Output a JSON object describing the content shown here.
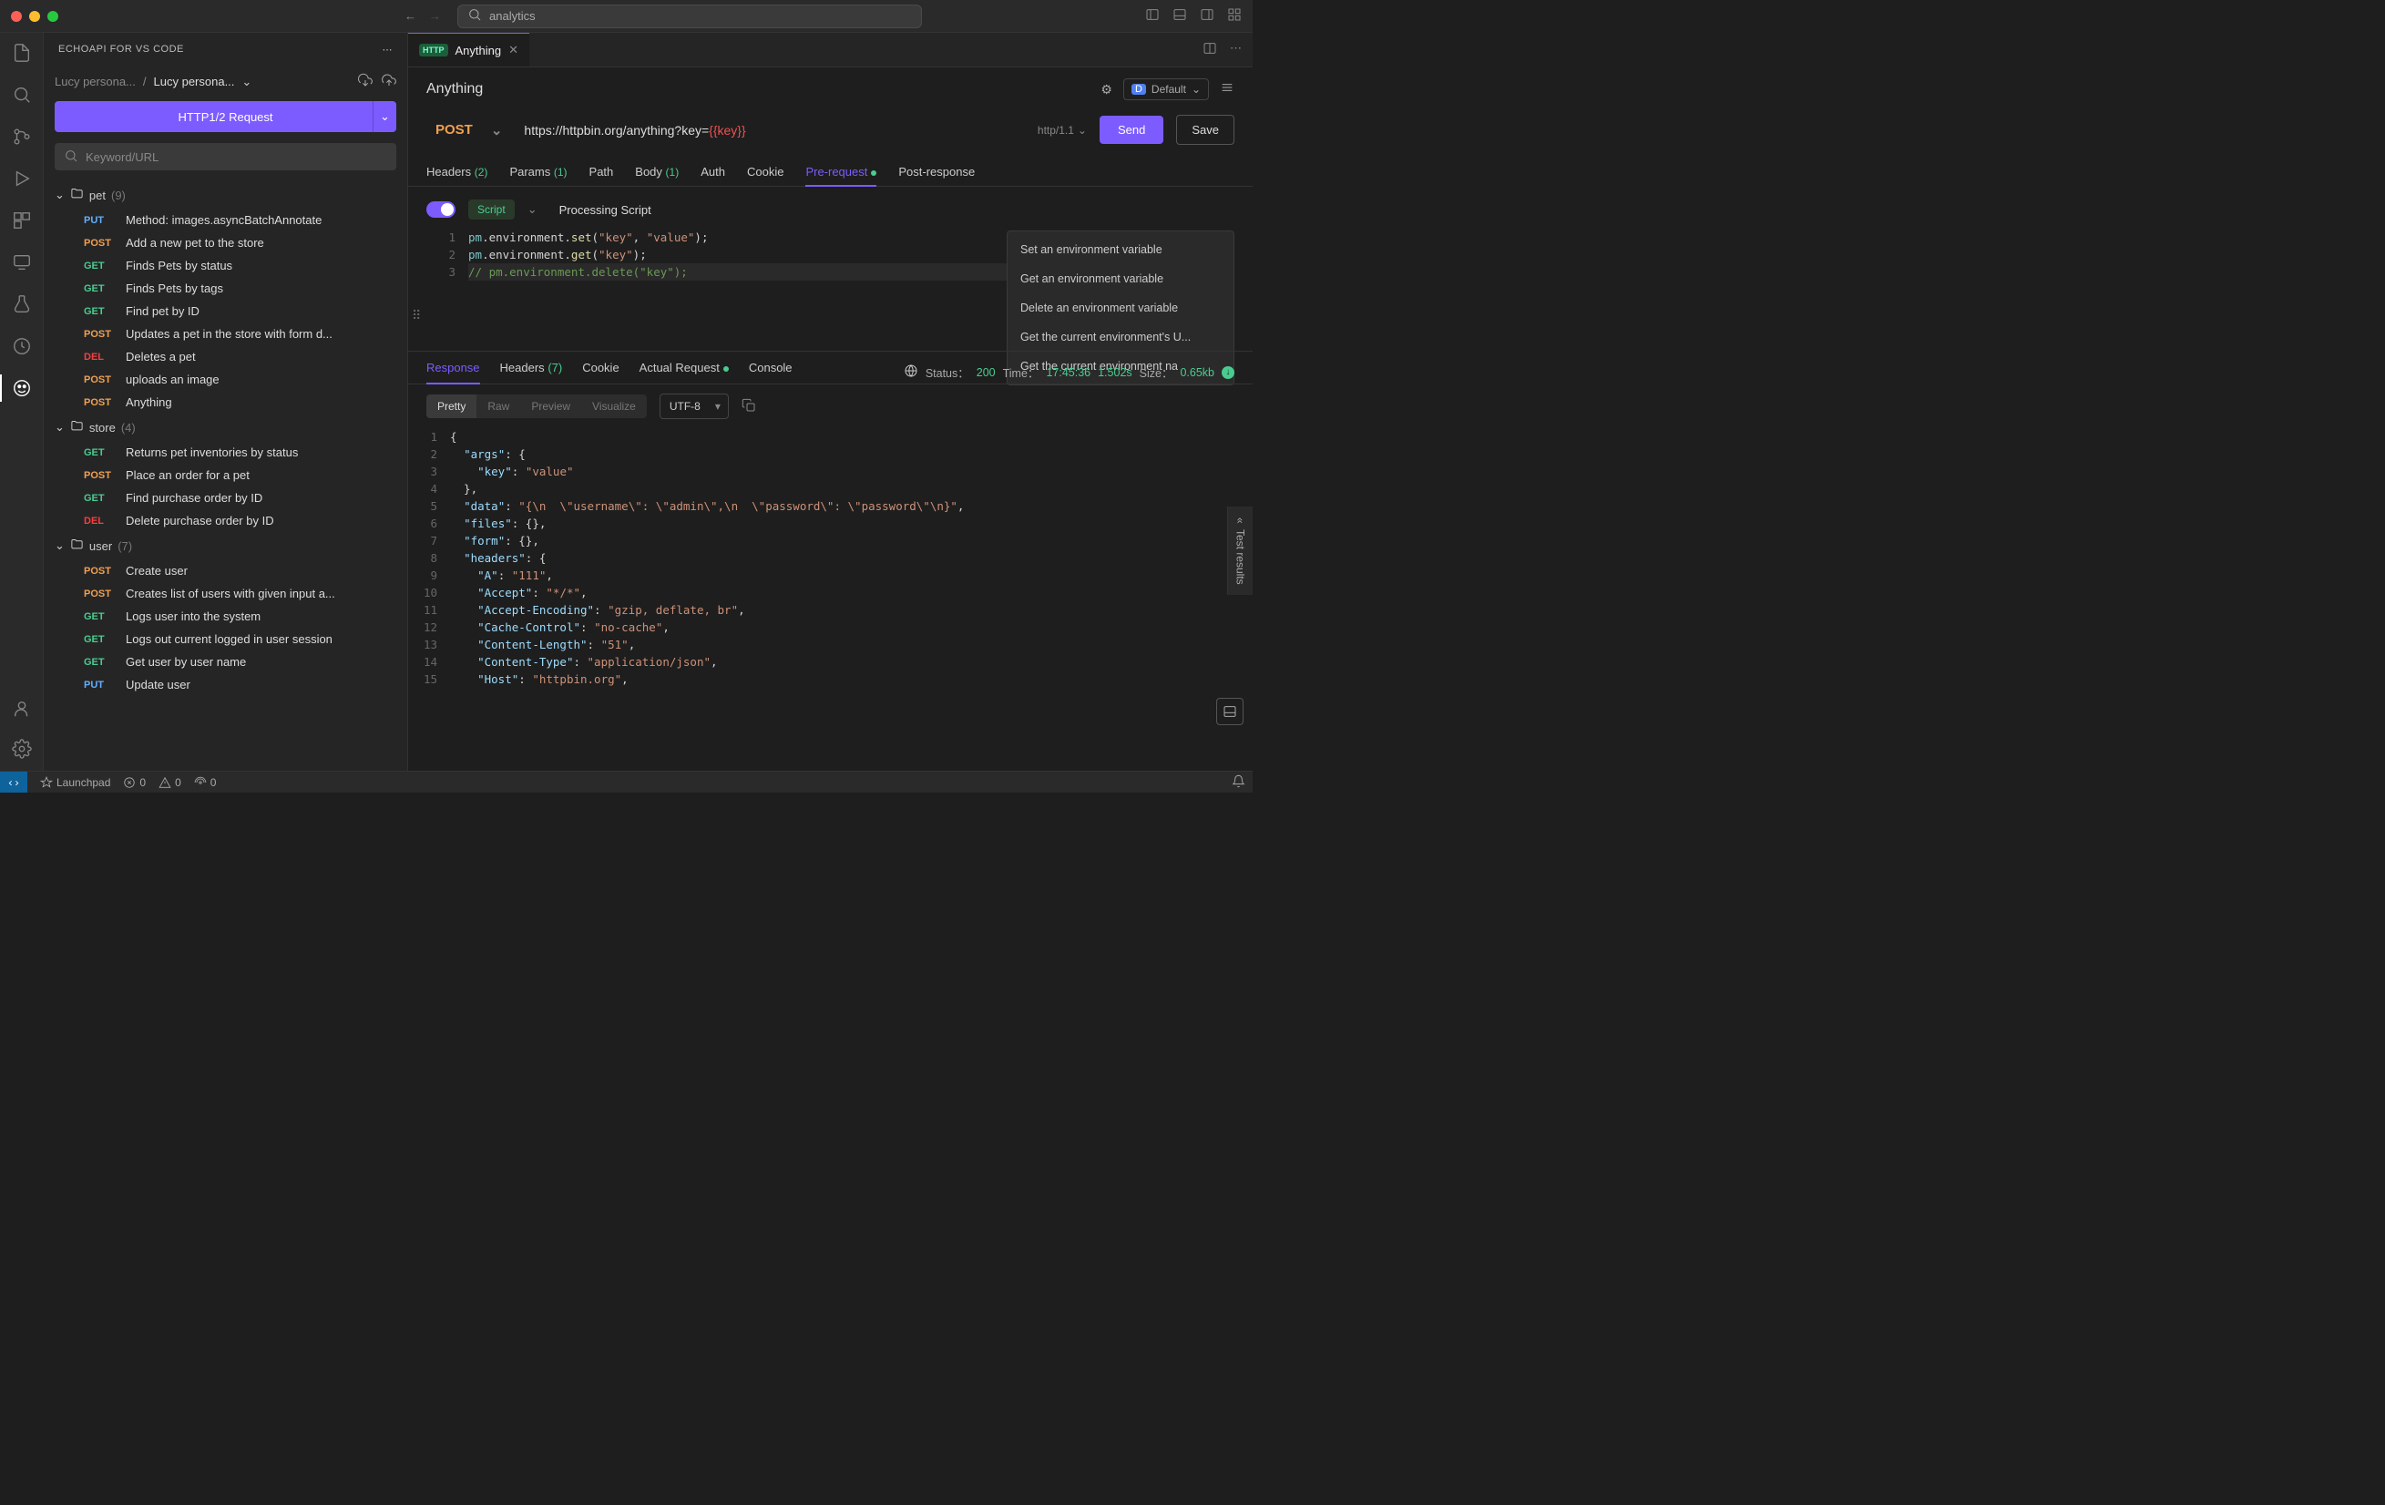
{
  "titlebar": {
    "search": "analytics"
  },
  "sidebar": {
    "title": "ECHOAPI FOR VS CODE",
    "breadcrumb": {
      "parent": "Lucy persona...",
      "current": "Lucy persona..."
    },
    "newRequest": "HTTP1/2 Request",
    "searchPlaceholder": "Keyword/URL",
    "folders": [
      {
        "name": "pet",
        "count": "(9)",
        "items": [
          {
            "method": "PUT",
            "cls": "m-put",
            "label": "Method: images.asyncBatchAnnotate"
          },
          {
            "method": "POST",
            "cls": "m-post",
            "label": "Add a new pet to the store"
          },
          {
            "method": "GET",
            "cls": "m-get",
            "label": "Finds Pets by status"
          },
          {
            "method": "GET",
            "cls": "m-get",
            "label": "Finds Pets by tags"
          },
          {
            "method": "GET",
            "cls": "m-get",
            "label": "Find pet by ID"
          },
          {
            "method": "POST",
            "cls": "m-post",
            "label": "Updates a pet in the store with form d..."
          },
          {
            "method": "DEL",
            "cls": "m-del",
            "label": "Deletes a pet"
          },
          {
            "method": "POST",
            "cls": "m-post",
            "label": "uploads an image"
          },
          {
            "method": "POST",
            "cls": "m-post",
            "label": "Anything"
          }
        ]
      },
      {
        "name": "store",
        "count": "(4)",
        "items": [
          {
            "method": "GET",
            "cls": "m-get",
            "label": "Returns pet inventories by status"
          },
          {
            "method": "POST",
            "cls": "m-post",
            "label": "Place an order for a pet"
          },
          {
            "method": "GET",
            "cls": "m-get",
            "label": "Find purchase order by ID"
          },
          {
            "method": "DEL",
            "cls": "m-del",
            "label": "Delete purchase order by ID"
          }
        ]
      },
      {
        "name": "user",
        "count": "(7)",
        "items": [
          {
            "method": "POST",
            "cls": "m-post",
            "label": "Create user"
          },
          {
            "method": "POST",
            "cls": "m-post",
            "label": "Creates list of users with given input a..."
          },
          {
            "method": "GET",
            "cls": "m-get",
            "label": "Logs user into the system"
          },
          {
            "method": "GET",
            "cls": "m-get",
            "label": "Logs out current logged in user session"
          },
          {
            "method": "GET",
            "cls": "m-get",
            "label": "Get user by user name"
          },
          {
            "method": "PUT",
            "cls": "m-put",
            "label": "Update user"
          }
        ]
      }
    ]
  },
  "editor": {
    "tabLabel": "Anything",
    "title": "Anything",
    "env": "Default",
    "method": "POST",
    "urlBase": "https://httpbin.org/anything?key=",
    "urlVar": "{{key}}",
    "protocol": "http/1.1",
    "sendBtn": "Send",
    "saveBtn": "Save",
    "tabs": {
      "headers": "Headers",
      "headersCount": "(2)",
      "params": "Params",
      "paramsCount": "(1)",
      "path": "Path",
      "body": "Body",
      "bodyCount": "(1)",
      "auth": "Auth",
      "cookie": "Cookie",
      "preRequest": "Pre-request",
      "postResponse": "Post-response"
    },
    "script": {
      "badge": "Script",
      "title": "Processing Script",
      "lines": [
        [
          {
            "t": "pm",
            "c": "tk-var"
          },
          {
            "t": ".",
            "c": "tk-punc"
          },
          {
            "t": "environment",
            "c": "tk-prop"
          },
          {
            "t": ".",
            "c": "tk-punc"
          },
          {
            "t": "set",
            "c": "tk-func"
          },
          {
            "t": "(",
            "c": "tk-punc"
          },
          {
            "t": "\"key\"",
            "c": "tk-str"
          },
          {
            "t": ", ",
            "c": "tk-punc"
          },
          {
            "t": "\"value\"",
            "c": "tk-str"
          },
          {
            "t": ");",
            "c": "tk-punc"
          }
        ],
        [
          {
            "t": "pm",
            "c": "tk-var"
          },
          {
            "t": ".",
            "c": "tk-punc"
          },
          {
            "t": "environment",
            "c": "tk-prop"
          },
          {
            "t": ".",
            "c": "tk-punc"
          },
          {
            "t": "get",
            "c": "tk-func"
          },
          {
            "t": "(",
            "c": "tk-punc"
          },
          {
            "t": "\"key\"",
            "c": "tk-str"
          },
          {
            "t": ");",
            "c": "tk-punc"
          }
        ],
        [
          {
            "t": "// pm.environment.delete(\"key\");",
            "c": "tk-comment"
          }
        ]
      ],
      "snippets": [
        "Set an environment variable",
        "Get an environment variable",
        "Delete an environment variable",
        "Get the current environment's U...",
        "Get the current environment na"
      ]
    }
  },
  "response": {
    "tabs": {
      "response": "Response",
      "headers": "Headers",
      "headersCount": "(7)",
      "cookie": "Cookie",
      "actualRequest": "Actual Request",
      "console": "Console"
    },
    "status": {
      "statusLbl": "Status：",
      "statusVal": "200",
      "timeLbl": "Time：",
      "timeVal1": "17:45:36",
      "timeVal2": "1.502s",
      "sizeLbl": "Size：",
      "sizeVal": "0.65kb"
    },
    "viewTabs": {
      "pretty": "Pretty",
      "raw": "Raw",
      "preview": "Preview",
      "visualize": "Visualize"
    },
    "encoding": "UTF-8",
    "body": [
      [
        {
          "t": "{",
          "c": "tk-punc"
        }
      ],
      [
        {
          "t": "  ",
          "c": ""
        },
        {
          "t": "\"args\"",
          "c": "tk-key"
        },
        {
          "t": ": {",
          "c": "tk-punc"
        }
      ],
      [
        {
          "t": "    ",
          "c": ""
        },
        {
          "t": "\"key\"",
          "c": "tk-key"
        },
        {
          "t": ": ",
          "c": "tk-punc"
        },
        {
          "t": "\"value\"",
          "c": "tk-str"
        }
      ],
      [
        {
          "t": "  },",
          "c": "tk-punc"
        }
      ],
      [
        {
          "t": "  ",
          "c": ""
        },
        {
          "t": "\"data\"",
          "c": "tk-key"
        },
        {
          "t": ": ",
          "c": "tk-punc"
        },
        {
          "t": "\"{\\n  \\\"username\\\": \\\"admin\\\",\\n  \\\"password\\\": \\\"password\\\"\\n}\"",
          "c": "tk-str"
        },
        {
          "t": ",",
          "c": "tk-punc"
        }
      ],
      [
        {
          "t": "  ",
          "c": ""
        },
        {
          "t": "\"files\"",
          "c": "tk-key"
        },
        {
          "t": ": {},",
          "c": "tk-punc"
        }
      ],
      [
        {
          "t": "  ",
          "c": ""
        },
        {
          "t": "\"form\"",
          "c": "tk-key"
        },
        {
          "t": ": {},",
          "c": "tk-punc"
        }
      ],
      [
        {
          "t": "  ",
          "c": ""
        },
        {
          "t": "\"headers\"",
          "c": "tk-key"
        },
        {
          "t": ": {",
          "c": "tk-punc"
        }
      ],
      [
        {
          "t": "    ",
          "c": ""
        },
        {
          "t": "\"A\"",
          "c": "tk-key"
        },
        {
          "t": ": ",
          "c": "tk-punc"
        },
        {
          "t": "\"111\"",
          "c": "tk-str"
        },
        {
          "t": ",",
          "c": "tk-punc"
        }
      ],
      [
        {
          "t": "    ",
          "c": ""
        },
        {
          "t": "\"Accept\"",
          "c": "tk-key"
        },
        {
          "t": ": ",
          "c": "tk-punc"
        },
        {
          "t": "\"*/*\"",
          "c": "tk-str"
        },
        {
          "t": ",",
          "c": "tk-punc"
        }
      ],
      [
        {
          "t": "    ",
          "c": ""
        },
        {
          "t": "\"Accept-Encoding\"",
          "c": "tk-key"
        },
        {
          "t": ": ",
          "c": "tk-punc"
        },
        {
          "t": "\"gzip, deflate, br\"",
          "c": "tk-str"
        },
        {
          "t": ",",
          "c": "tk-punc"
        }
      ],
      [
        {
          "t": "    ",
          "c": ""
        },
        {
          "t": "\"Cache-Control\"",
          "c": "tk-key"
        },
        {
          "t": ": ",
          "c": "tk-punc"
        },
        {
          "t": "\"no-cache\"",
          "c": "tk-str"
        },
        {
          "t": ",",
          "c": "tk-punc"
        }
      ],
      [
        {
          "t": "    ",
          "c": ""
        },
        {
          "t": "\"Content-Length\"",
          "c": "tk-key"
        },
        {
          "t": ": ",
          "c": "tk-punc"
        },
        {
          "t": "\"51\"",
          "c": "tk-str"
        },
        {
          "t": ",",
          "c": "tk-punc"
        }
      ],
      [
        {
          "t": "    ",
          "c": ""
        },
        {
          "t": "\"Content-Type\"",
          "c": "tk-key"
        },
        {
          "t": ": ",
          "c": "tk-punc"
        },
        {
          "t": "\"application/json\"",
          "c": "tk-str"
        },
        {
          "t": ",",
          "c": "tk-punc"
        }
      ],
      [
        {
          "t": "    ",
          "c": ""
        },
        {
          "t": "\"Host\"",
          "c": "tk-key"
        },
        {
          "t": ": ",
          "c": "tk-punc"
        },
        {
          "t": "\"httpbin.org\"",
          "c": "tk-str"
        },
        {
          "t": ",",
          "c": "tk-punc"
        }
      ]
    ],
    "testResults": "Test results"
  },
  "statusBar": {
    "launchpad": "Launchpad",
    "err": "0",
    "warn": "0",
    "port": "0"
  }
}
